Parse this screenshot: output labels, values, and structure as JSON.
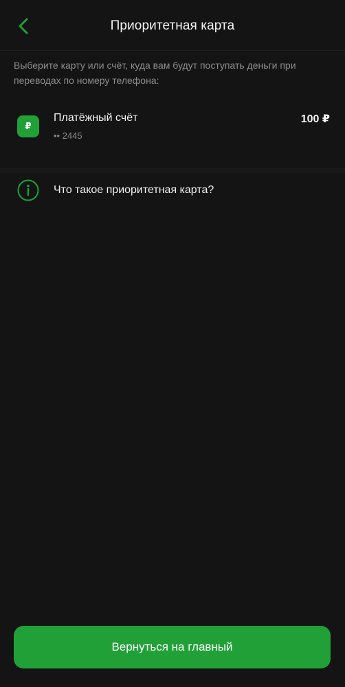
{
  "header": {
    "title": "Приоритетная карта",
    "back_icon": "chevron-left-icon"
  },
  "description": "Выберите карту или счёт, куда вам будут поступать деньги при переводах по номеру телефона:",
  "account": {
    "icon_glyph": "₽",
    "name": "Платёжный счёт",
    "number": "•• 2445",
    "amount": "100 ₽"
  },
  "info": {
    "label": "Что такое приоритетная карта?",
    "icon": "info-circle-icon"
  },
  "footer": {
    "button_label": "Вернуться на главный"
  },
  "colors": {
    "background": "#141414",
    "accent": "#21a038",
    "text_primary": "#f4f4f4",
    "text_secondary": "#8c8c8c"
  }
}
